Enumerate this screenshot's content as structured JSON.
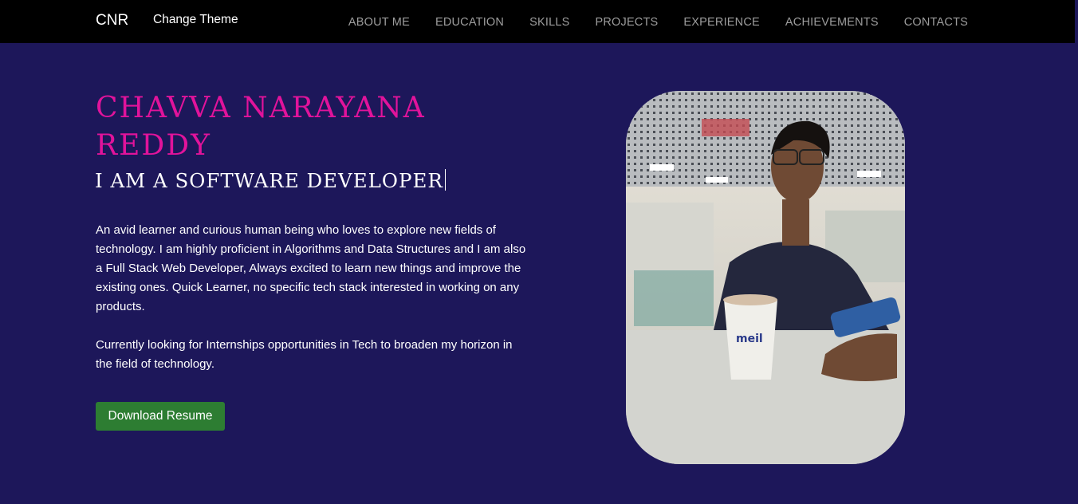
{
  "nav": {
    "brand": "CNR",
    "theme_toggle": "Change Theme",
    "links": [
      "ABOUT ME",
      "EDUCATION",
      "SKILLS",
      "PROJECTS",
      "EXPERIENCE",
      "ACHIEVEMENTS",
      "CONTACTS"
    ]
  },
  "hero": {
    "name": "CHAVVA NARAYANA REDDY",
    "tagline": "I AM A SOFTWARE DEVELOPER",
    "bio_1": "An avid learner and curious human being who loves to explore new fields of technology. I am highly proficient in Algorithms and Data Structures and I am also a Full Stack Web Developer, Always excited to learn new things and improve the existing ones. Quick Learner, no specific tech stack interested in working on any products.",
    "bio_2": "Currently looking for Internships opportunities in Tech to broaden my horizon in the field of technology.",
    "resume_button": "Download Resume"
  },
  "colors": {
    "background": "#1d175a",
    "navbar": "#000000",
    "name_accent": "#e1139b",
    "button": "#2d7d32"
  }
}
